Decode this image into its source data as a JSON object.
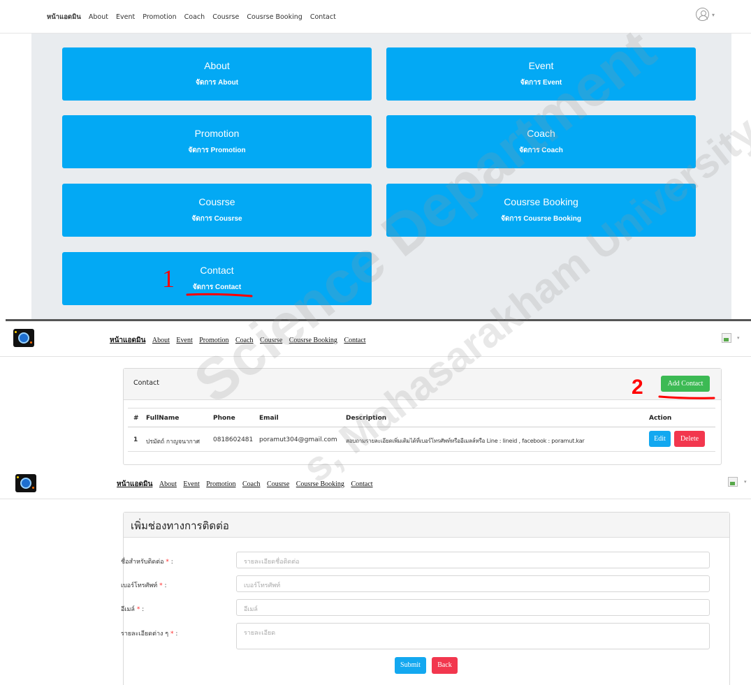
{
  "admin_nav": {
    "brand": "หน้าแอดมิน",
    "items": [
      "About",
      "Event",
      "Promotion",
      "Coach",
      "Cousrse",
      "Cousrse Booking",
      "Contact"
    ],
    "user_caret": "▾"
  },
  "cards": [
    {
      "title": "About",
      "subtitle": "จัดการ About"
    },
    {
      "title": "Event",
      "subtitle": "จัดการ Event"
    },
    {
      "title": "Promotion",
      "subtitle": "จัดการ Promotion"
    },
    {
      "title": "Coach",
      "subtitle": "จัดการ Coach"
    },
    {
      "title": "Cousrse",
      "subtitle": "จัดการ Cousrse"
    },
    {
      "title": "Cousrse Booking",
      "subtitle": "จัดการ Cousrse Booking"
    },
    {
      "title": "Contact",
      "subtitle": "จัดการ Contact"
    }
  ],
  "annotations": {
    "step1": "1",
    "step2": "2"
  },
  "contact_list": {
    "title": "Contact",
    "add_button": "Add Contact",
    "columns": [
      "#",
      "FullName",
      "Phone",
      "Email",
      "Description",
      "Action"
    ],
    "rows": [
      {
        "num": "1",
        "fullname": "ปรมัตถ์ กาญจนากาศ",
        "phone": "0818602481",
        "email": "poramut304@gmail.com",
        "description": "สอบถามรายละเอียดเพิ่มเติมได้ที่เบอร์โทรศัพท์หรืออีเมลล์หรือ Line : lineid , facebook : poramut.kar",
        "edit_label": "Edit",
        "delete_label": "Delete"
      }
    ]
  },
  "contact_form": {
    "title": "เพิ่มช่องทางการติดต่อ",
    "fields": [
      {
        "label": "ชื่อสำหรับติดต่อ",
        "required": "*",
        "colon": " :",
        "placeholder": "รายละเอียดชื่อติดต่อ"
      },
      {
        "label": "เบอร์โทรศัพท์",
        "required": "*",
        "colon": " :",
        "placeholder": "เบอร์โทรศัพท์"
      },
      {
        "label": "อีเมล์",
        "required": "*",
        "colon": " :",
        "placeholder": "อีเมล์"
      },
      {
        "label": "รายละเอียดต่าง ๆ",
        "required": "*",
        "colon": " :",
        "placeholder": "รายละเอียด"
      }
    ],
    "submit_label": "Submit",
    "back_label": "Back"
  },
  "watermark": {
    "line1": "Science Department",
    "line2": "s, Mahasarakham University"
  },
  "colors": {
    "card_blue": "#03a9f4",
    "admin_bg": "#e9ecef",
    "btn_green": "#3cba54",
    "btn_blue": "#13a8f0",
    "btn_red": "#f2374e",
    "annotation_red": "#ff0000"
  },
  "icons": {
    "user": "user-circle-icon",
    "logo": "site-logo-icon",
    "broken_image": "broken-image-icon"
  }
}
